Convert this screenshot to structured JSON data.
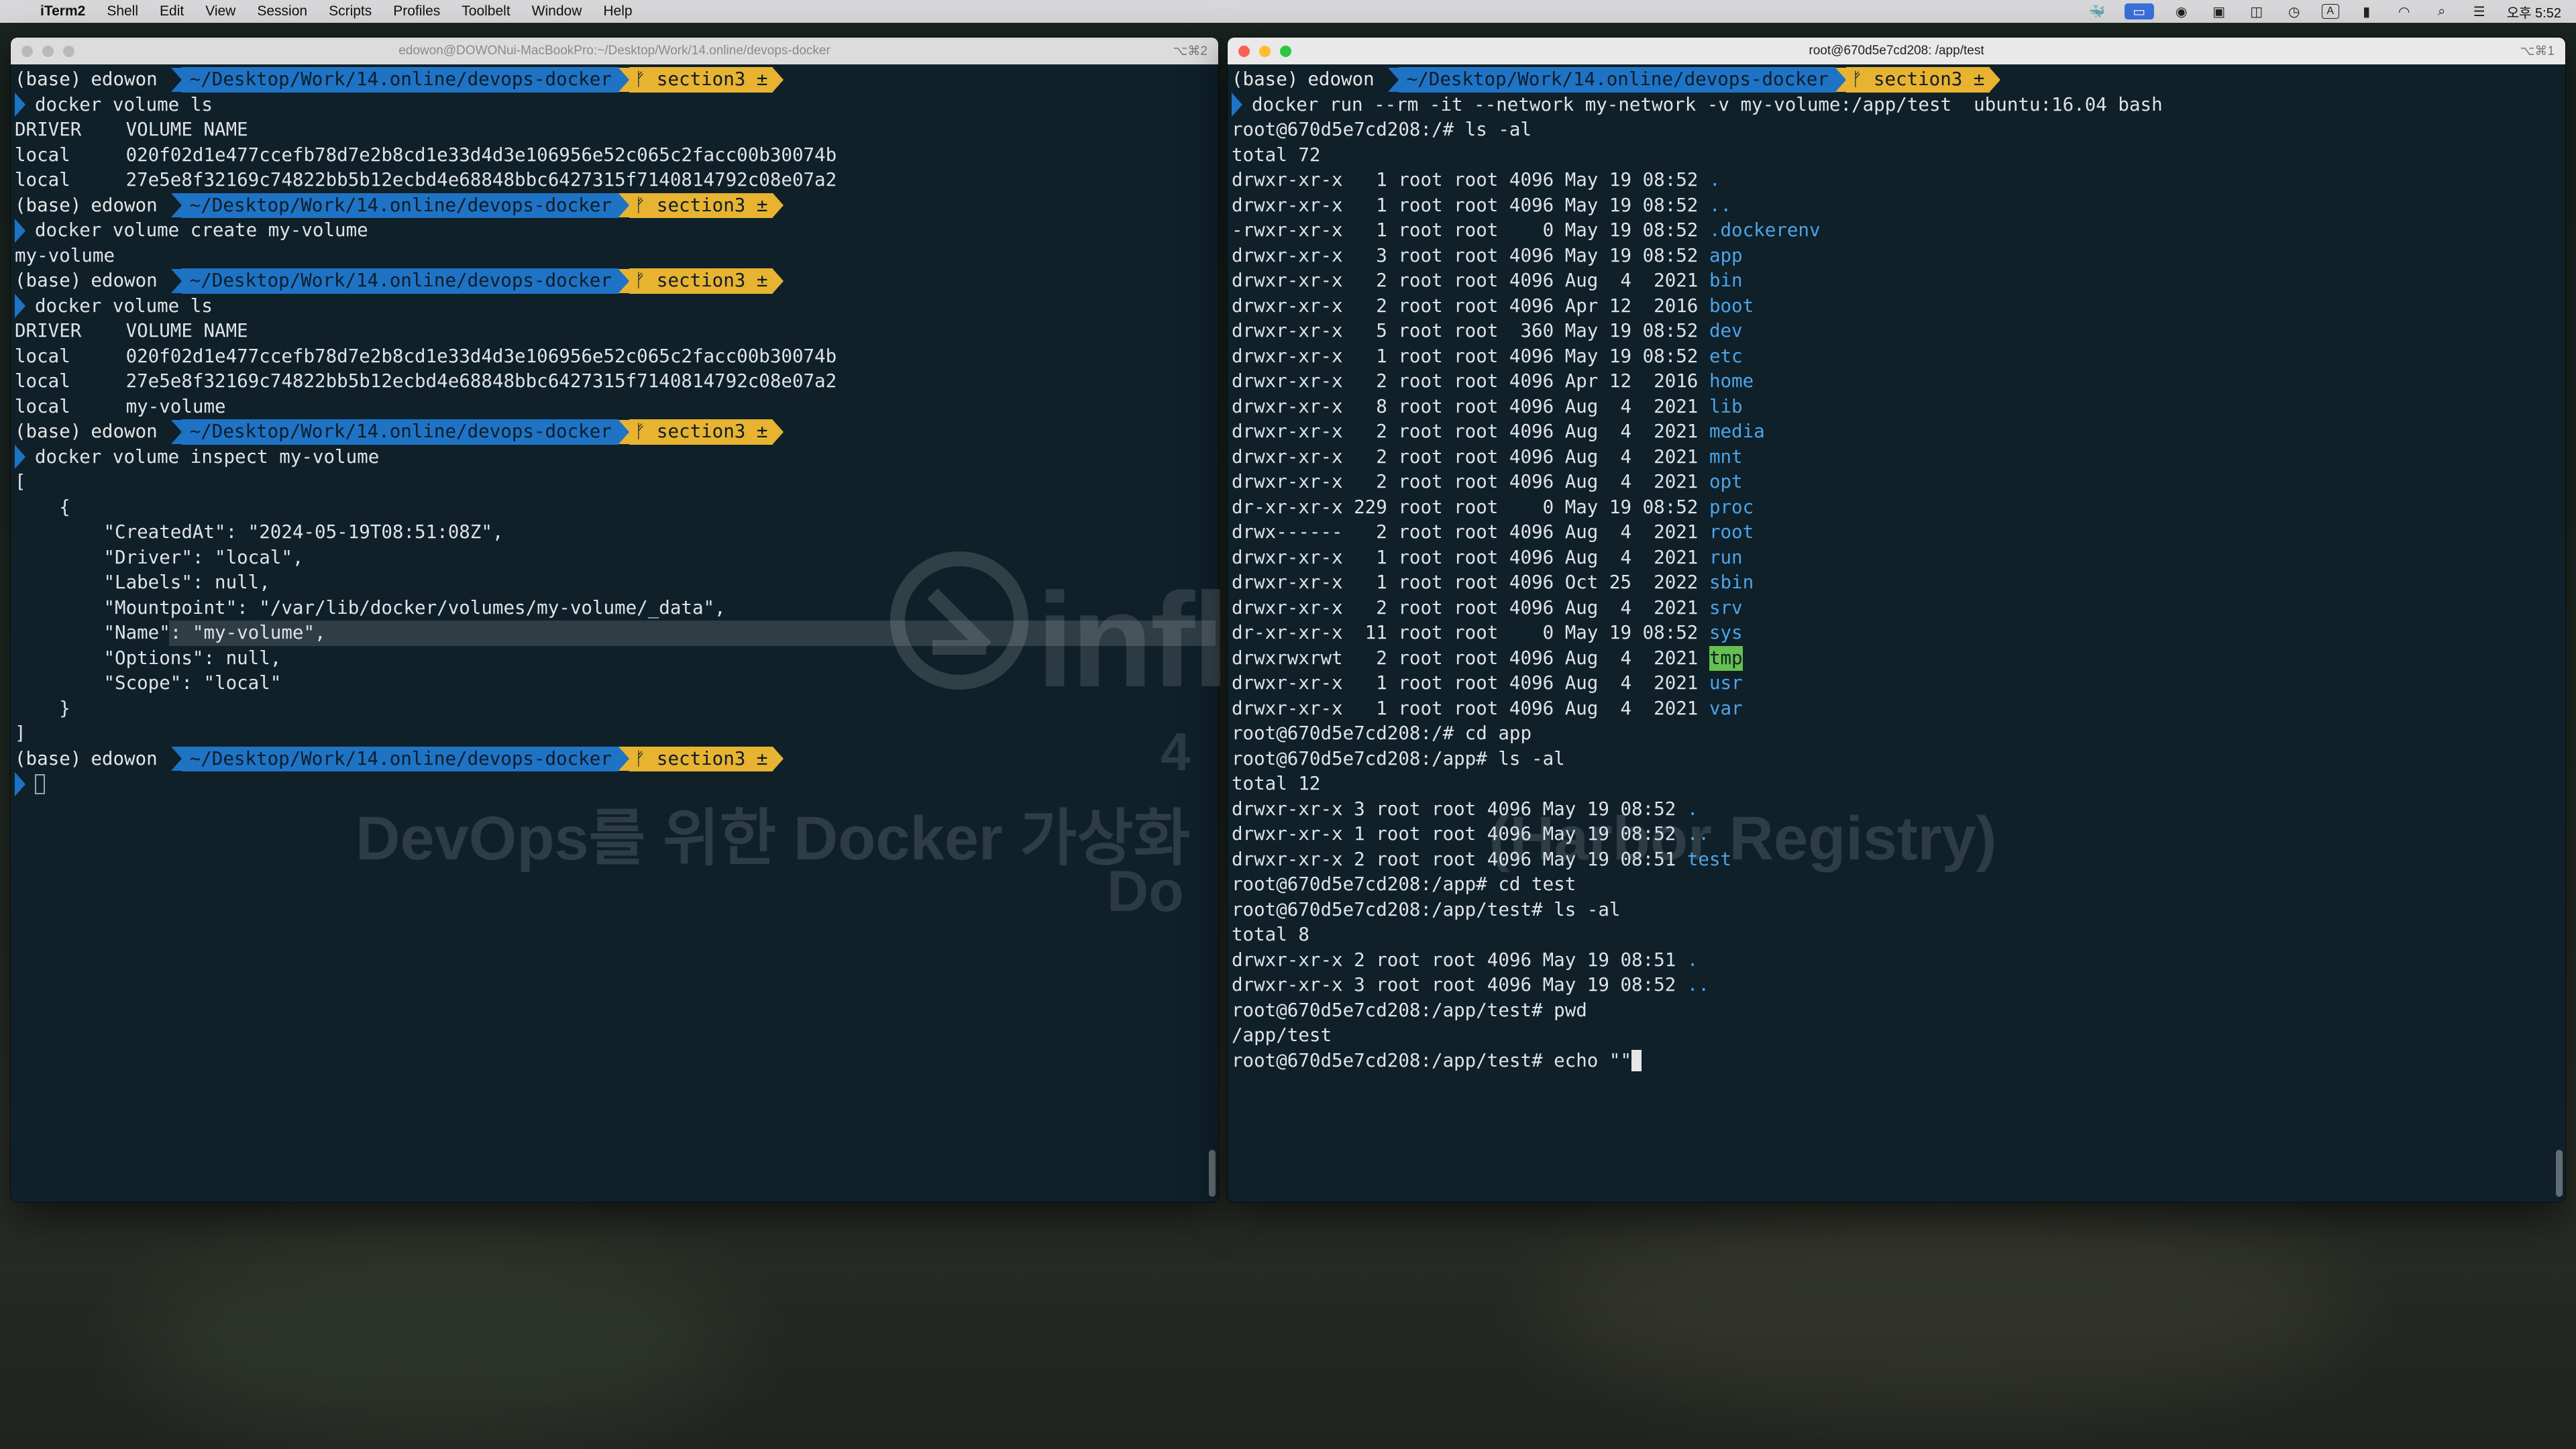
{
  "menubar": {
    "app": "iTerm2",
    "items": [
      "Shell",
      "Edit",
      "View",
      "Session",
      "Scripts",
      "Profiles",
      "Toolbelt",
      "Window",
      "Help"
    ],
    "clock": "오후 5:52",
    "input_indicator": "A"
  },
  "left_window": {
    "title": "edowon@DOWONui-MacBookPro:~/Desktop/Work/14.online/devops-docker",
    "shortcut": "⌥⌘2",
    "prompt": {
      "env": "(base)",
      "user": "edowon",
      "path": "~/Desktop/Work/14.online/devops-docker",
      "branch": "ᚠ section3 ±"
    },
    "lines": [
      {
        "kind": "prompt"
      },
      {
        "kind": "cmd",
        "text": "docker volume ls"
      },
      {
        "kind": "out",
        "text": "DRIVER    VOLUME NAME"
      },
      {
        "kind": "out",
        "text": "local     020f02d1e477ccefb78d7e2b8cd1e33d4d3e106956e52c065c2facc00b30074b"
      },
      {
        "kind": "out",
        "text": "local     27e5e8f32169c74822bb5b12ecbd4e68848bbc6427315f7140814792c08e07a2"
      },
      {
        "kind": "prompt"
      },
      {
        "kind": "cmd",
        "text": "docker volume create my-volume"
      },
      {
        "kind": "out",
        "text": "my-volume"
      },
      {
        "kind": "prompt"
      },
      {
        "kind": "cmd",
        "text": "docker volume ls"
      },
      {
        "kind": "out",
        "text": "DRIVER    VOLUME NAME"
      },
      {
        "kind": "out",
        "text": "local     020f02d1e477ccefb78d7e2b8cd1e33d4d3e106956e52c065c2facc00b30074b"
      },
      {
        "kind": "out",
        "text": "local     27e5e8f32169c74822bb5b12ecbd4e68848bbc6427315f7140814792c08e07a2"
      },
      {
        "kind": "out",
        "text": "local     my-volume"
      },
      {
        "kind": "prompt"
      },
      {
        "kind": "cmd",
        "text": "docker volume inspect my-volume"
      },
      {
        "kind": "out",
        "text": "["
      },
      {
        "kind": "out",
        "text": "    {"
      },
      {
        "kind": "out",
        "text": "        \"CreatedAt\": \"2024-05-19T08:51:08Z\","
      },
      {
        "kind": "out",
        "text": "        \"Driver\": \"local\","
      },
      {
        "kind": "out",
        "text": "        \"Labels\": null,"
      },
      {
        "kind": "out",
        "text": "        \"Mountpoint\": \"/var/lib/docker/volumes/my-volume/_data\","
      },
      {
        "kind": "out",
        "text": "        \"Name\": \"my-volume\",",
        "highlight": true
      },
      {
        "kind": "out",
        "text": "        \"Options\": null,"
      },
      {
        "kind": "out",
        "text": "        \"Scope\": \"local\""
      },
      {
        "kind": "out",
        "text": "    }"
      },
      {
        "kind": "out",
        "text": "]"
      },
      {
        "kind": "prompt"
      },
      {
        "kind": "cursor"
      }
    ]
  },
  "right_window": {
    "title": "root@670d5e7cd208: /app/test",
    "shortcut": "⌥⌘1",
    "prompt": {
      "env": "(base)",
      "user": "edowon",
      "path": "~/Desktop/Work/14.online/devops-docker",
      "branch": "ᚠ section3 ±"
    },
    "lines": [
      {
        "kind": "prompt"
      },
      {
        "kind": "cmd",
        "text": "docker run --rm -it --network my-network -v my-volume:/app/test  ubuntu:16.04 bash"
      },
      {
        "kind": "out",
        "text": "root@670d5e7cd208:/# ls -al"
      },
      {
        "kind": "out",
        "text": "total 72"
      },
      {
        "kind": "ls",
        "text": "drwxr-xr-x   1 root root 4096 May 19 08:52 ",
        "name": "."
      },
      {
        "kind": "ls",
        "text": "drwxr-xr-x   1 root root 4096 May 19 08:52 ",
        "name": ".."
      },
      {
        "kind": "ls",
        "text": "-rwxr-xr-x   1 root root    0 May 19 08:52 ",
        "name": ".dockerenv"
      },
      {
        "kind": "ls",
        "text": "drwxr-xr-x   3 root root 4096 May 19 08:52 ",
        "name": "app"
      },
      {
        "kind": "ls",
        "text": "drwxr-xr-x   2 root root 4096 Aug  4  2021 ",
        "name": "bin"
      },
      {
        "kind": "ls",
        "text": "drwxr-xr-x   2 root root 4096 Apr 12  2016 ",
        "name": "boot"
      },
      {
        "kind": "ls",
        "text": "drwxr-xr-x   5 root root  360 May 19 08:52 ",
        "name": "dev"
      },
      {
        "kind": "ls",
        "text": "drwxr-xr-x   1 root root 4096 May 19 08:52 ",
        "name": "etc"
      },
      {
        "kind": "ls",
        "text": "drwxr-xr-x   2 root root 4096 Apr 12  2016 ",
        "name": "home"
      },
      {
        "kind": "ls",
        "text": "drwxr-xr-x   8 root root 4096 Aug  4  2021 ",
        "name": "lib"
      },
      {
        "kind": "ls",
        "text": "drwxr-xr-x   2 root root 4096 Aug  4  2021 ",
        "name": "media"
      },
      {
        "kind": "ls",
        "text": "drwxr-xr-x   2 root root 4096 Aug  4  2021 ",
        "name": "mnt"
      },
      {
        "kind": "ls",
        "text": "drwxr-xr-x   2 root root 4096 Aug  4  2021 ",
        "name": "opt"
      },
      {
        "kind": "ls",
        "text": "dr-xr-xr-x 229 root root    0 May 19 08:52 ",
        "name": "proc"
      },
      {
        "kind": "ls",
        "text": "drwx------   2 root root 4096 Aug  4  2021 ",
        "name": "root"
      },
      {
        "kind": "ls",
        "text": "drwxr-xr-x   1 root root 4096 Aug  4  2021 ",
        "name": "run"
      },
      {
        "kind": "ls",
        "text": "drwxr-xr-x   1 root root 4096 Oct 25  2022 ",
        "name": "sbin"
      },
      {
        "kind": "ls",
        "text": "drwxr-xr-x   2 root root 4096 Aug  4  2021 ",
        "name": "srv"
      },
      {
        "kind": "ls",
        "text": "dr-xr-xr-x  11 root root    0 May 19 08:52 ",
        "name": "sys"
      },
      {
        "kind": "ls",
        "text": "drwxrwxrwt   2 root root 4096 Aug  4  2021 ",
        "name": "tmp",
        "sticky": true
      },
      {
        "kind": "ls",
        "text": "drwxr-xr-x   1 root root 4096 Aug  4  2021 ",
        "name": "usr"
      },
      {
        "kind": "ls",
        "text": "drwxr-xr-x   1 root root 4096 Aug  4  2021 ",
        "name": "var"
      },
      {
        "kind": "out",
        "text": "root@670d5e7cd208:/# cd app"
      },
      {
        "kind": "out",
        "text": "root@670d5e7cd208:/app# ls -al"
      },
      {
        "kind": "out",
        "text": "total 12"
      },
      {
        "kind": "ls",
        "text": "drwxr-xr-x 3 root root 4096 May 19 08:52 ",
        "name": "."
      },
      {
        "kind": "ls",
        "text": "drwxr-xr-x 1 root root 4096 May 19 08:52 ",
        "name": ".."
      },
      {
        "kind": "ls",
        "text": "drwxr-xr-x 2 root root 4096 May 19 08:51 ",
        "name": "test"
      },
      {
        "kind": "out",
        "text": "root@670d5e7cd208:/app# cd test"
      },
      {
        "kind": "out",
        "text": "root@670d5e7cd208:/app/test# ls -al"
      },
      {
        "kind": "out",
        "text": "total 8"
      },
      {
        "kind": "ls",
        "text": "drwxr-xr-x 2 root root 4096 May 19 08:51 ",
        "name": "."
      },
      {
        "kind": "ls",
        "text": "drwxr-xr-x 3 root root 4096 May 19 08:52 ",
        "name": ".."
      },
      {
        "kind": "out",
        "text": "root@670d5e7cd208:/app/test# pwd"
      },
      {
        "kind": "out",
        "text": "/app/test"
      },
      {
        "kind": "input",
        "text": "root@670d5e7cd208:/app/test# echo \"\""
      }
    ]
  },
  "watermark": {
    "brand": "infl",
    "line1": "4",
    "line2": "DevOps를 위한 Docker 가상화",
    "line2b": "(Harbor Registry)",
    "line3": "Do"
  },
  "colors": {
    "terminal_bg": "#0f2029",
    "text": "#dfe3e6",
    "powerline_path": "#1f73c4",
    "powerline_branch": "#e8b330",
    "dir": "#4da3e8",
    "sticky_dir_bg": "#65c050"
  }
}
